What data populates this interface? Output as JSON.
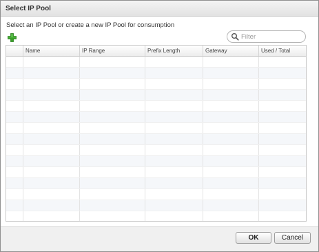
{
  "dialog": {
    "title": "Select IP Pool",
    "instruction": "Select an IP Pool or create a new IP Pool for consumption"
  },
  "toolbar": {
    "add_icon": "add-icon",
    "add_color": "#3aa12a"
  },
  "filter": {
    "placeholder": "Filter",
    "value": "",
    "icon": "search-icon"
  },
  "table": {
    "columns": [
      "",
      "Name",
      "IP Range",
      "Prefix Length",
      "Gateway",
      "Used / Total"
    ],
    "rows": []
  },
  "buttons": {
    "ok_label": "OK",
    "cancel_label": "Cancel"
  }
}
